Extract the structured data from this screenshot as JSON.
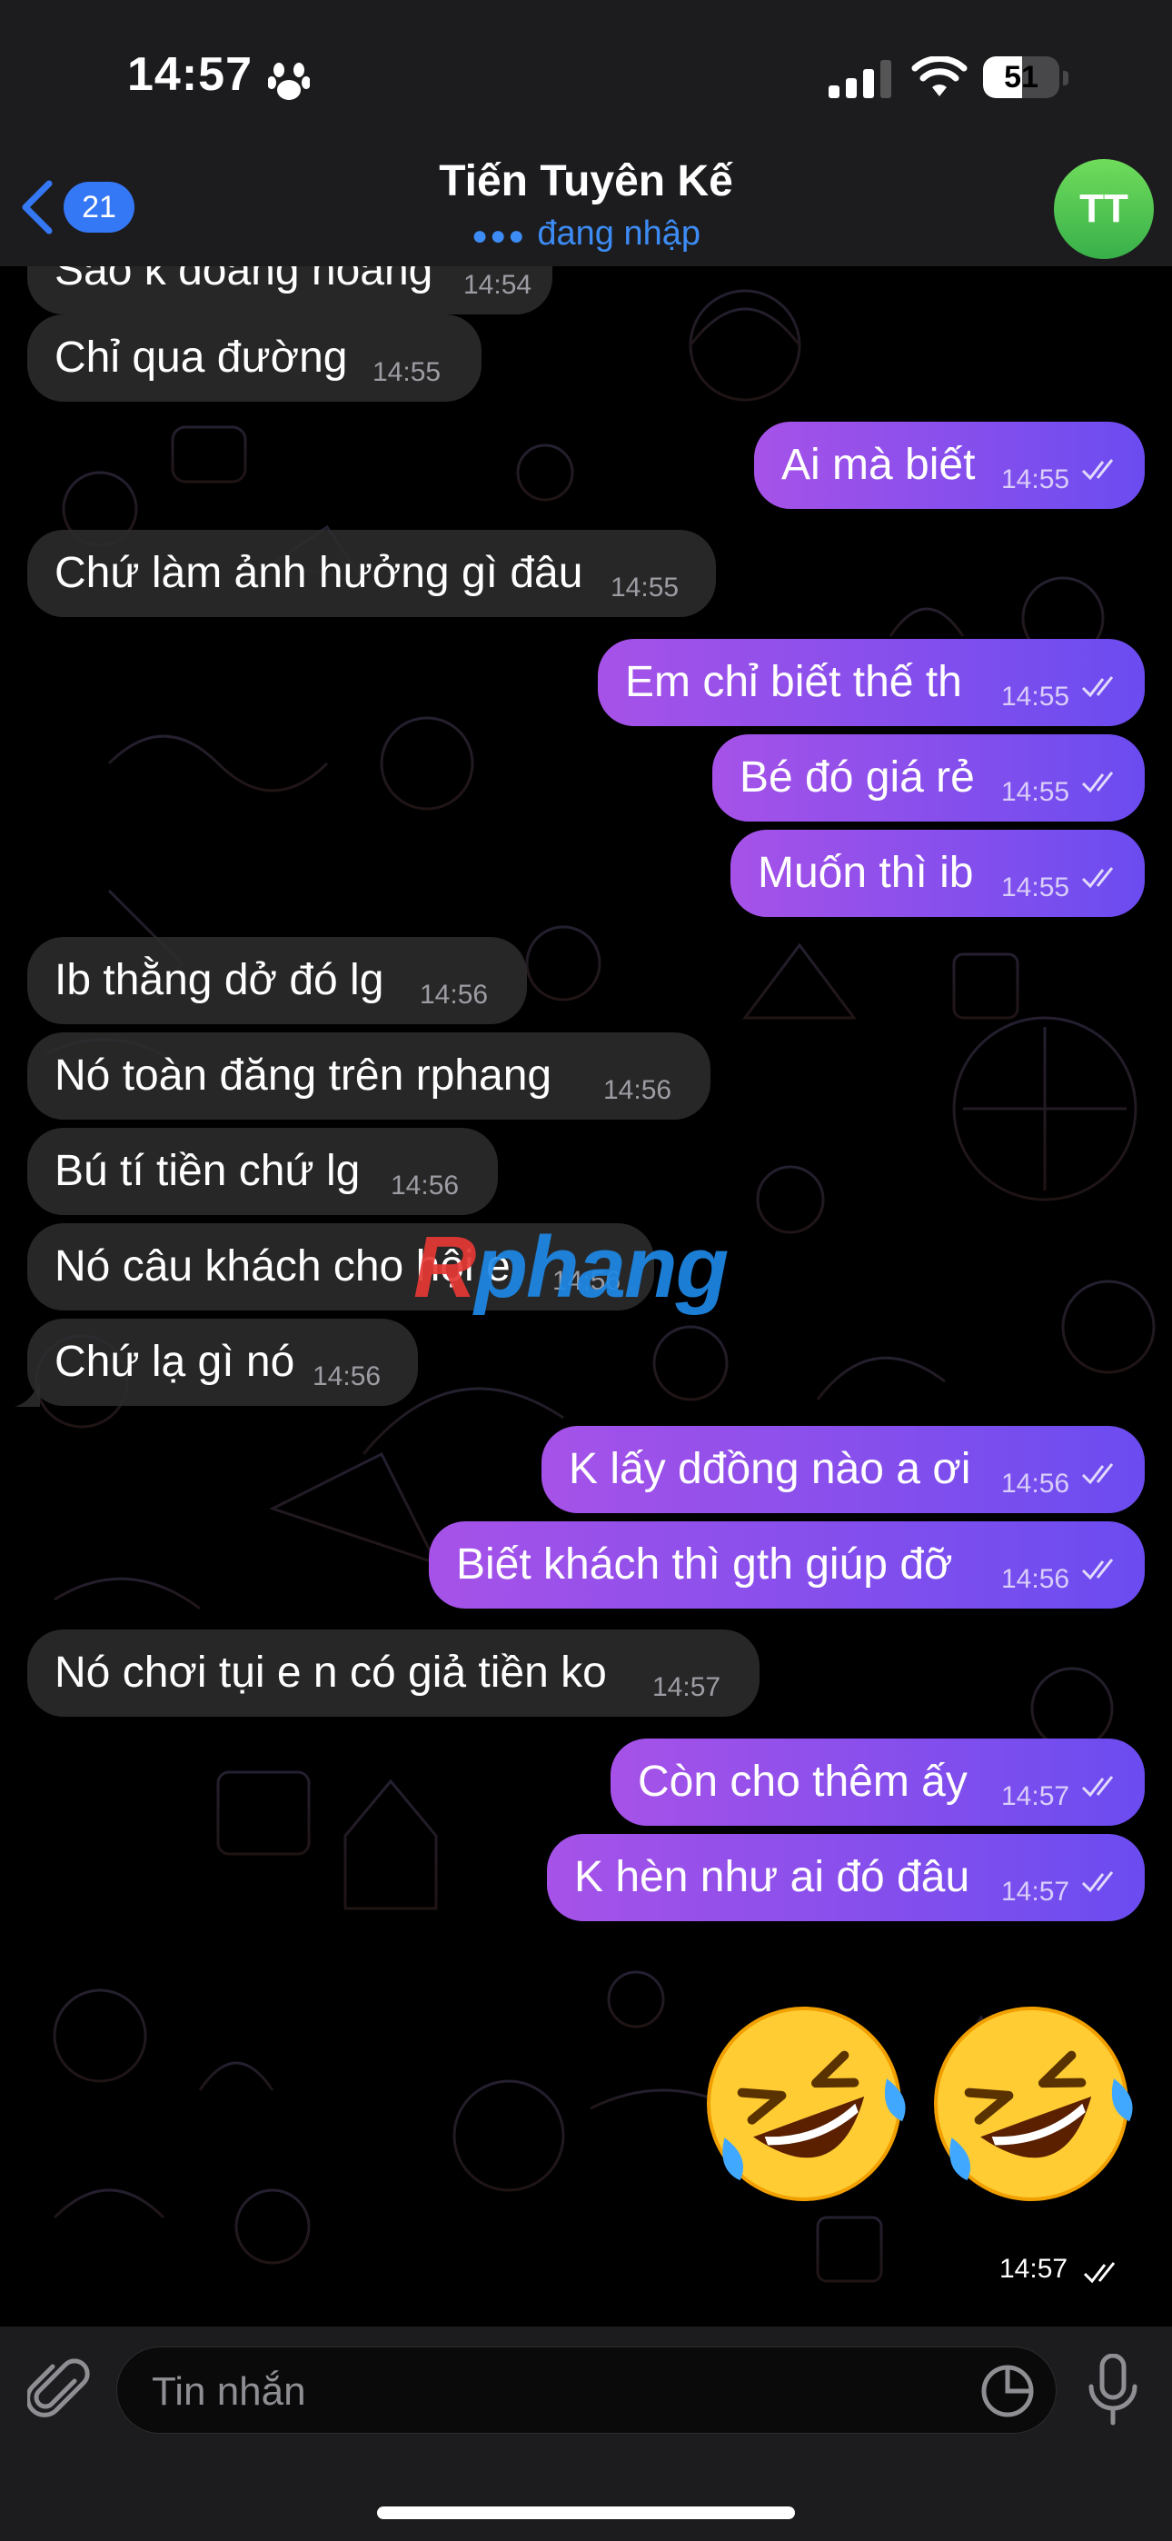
{
  "status_bar": {
    "time": "14:57",
    "battery_level": "51",
    "battery_percent": 51
  },
  "header": {
    "back_badge": "21",
    "title": "Tiến Tuyên Kế",
    "subtitle": "đang nhập",
    "avatar_initials": "TT"
  },
  "messages": [
    {
      "side": "in",
      "text": "Sao k đoàng hoàng",
      "time": "14:54"
    },
    {
      "side": "in",
      "text": "Chỉ qua đường",
      "time": "14:55"
    },
    {
      "side": "out",
      "text": "Ai mà biết",
      "time": "14:55"
    },
    {
      "side": "in",
      "text": "Chứ làm ảnh hưởng gì đâu",
      "time": "14:55"
    },
    {
      "side": "out",
      "text": "Em chỉ biết thế th",
      "time": "14:55"
    },
    {
      "side": "out",
      "text": "Bé đó giá rẻ",
      "time": "14:55"
    },
    {
      "side": "out",
      "text": "Muốn thì ib",
      "time": "14:55"
    },
    {
      "side": "in",
      "text": "Ib thằng dở đó lg",
      "time": "14:56"
    },
    {
      "side": "in",
      "text": "Nó toàn đăng trên rphang",
      "time": "14:56"
    },
    {
      "side": "in",
      "text": "Bú tí tiền chứ lg",
      "time": "14:56"
    },
    {
      "side": "in",
      "text": "Nó câu khách cho hội e",
      "time": "14:56"
    },
    {
      "side": "in",
      "text": "Chứ lạ gì nó",
      "time": "14:56"
    },
    {
      "side": "out",
      "text": "K lấy dđồng nào a ơi",
      "time": "14:56"
    },
    {
      "side": "out",
      "text": "Biết khách thì gth giúp đỡ",
      "time": "14:56"
    },
    {
      "side": "in",
      "text": "Nó chơi tụi e n có giả tiền ko",
      "time": "14:57"
    },
    {
      "side": "out",
      "text": "Còn cho thêm ấy",
      "time": "14:57"
    },
    {
      "side": "out",
      "text": "K hèn như ai đó đâu",
      "time": "14:57"
    }
  ],
  "emoji_message": {
    "emojis": [
      "🤣",
      "🤣"
    ],
    "time": "14:57"
  },
  "watermark": {
    "part1": "R",
    "part2": "phang"
  },
  "composer": {
    "placeholder": "Tin nhắn"
  },
  "colors": {
    "incoming": "#2c2c2e",
    "outgoing_start": "#a652e8",
    "outgoing_end": "#6b4cf0",
    "accent": "#3478f6"
  }
}
